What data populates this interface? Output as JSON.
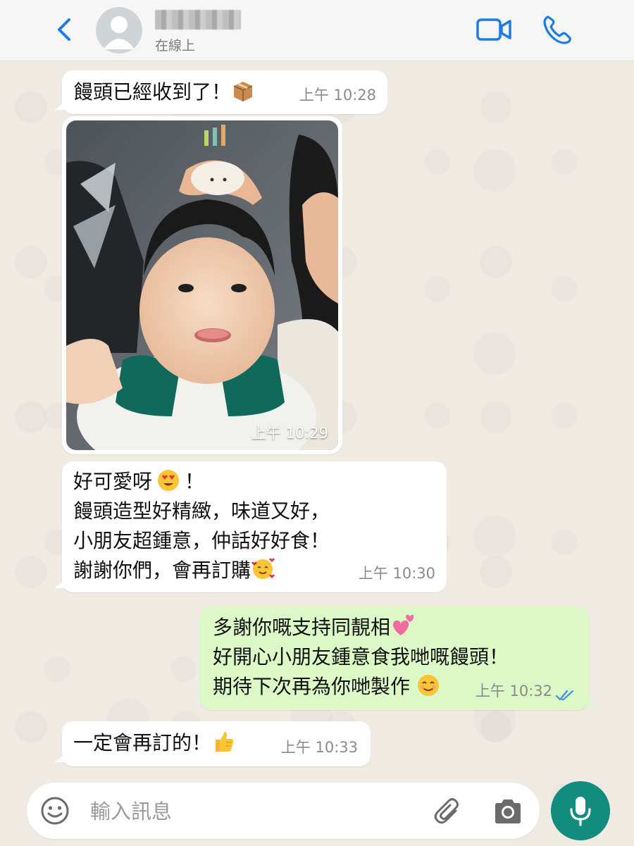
{
  "header": {
    "status": "在線上"
  },
  "messages": [
    {
      "id": "m1",
      "direction": "in",
      "lines": [
        "饅頭已經收到了！"
      ],
      "emoji": "package",
      "time": "上午 10:28"
    },
    {
      "id": "m2",
      "direction": "in",
      "type": "photo",
      "image": "toddler-with-cake-toy-on-head",
      "time": "上午 10:29"
    },
    {
      "id": "m3",
      "direction": "in",
      "lines": [
        "好可愛呀",
        "！",
        "饅頭造型好精緻，味道又好，",
        "小朋友超鍾意，仲話好好食！",
        "謝謝你們，會再訂購"
      ],
      "emoji": [
        "heart-eyes",
        "smiling-face-with-hearts"
      ],
      "time": "上午 10:30"
    },
    {
      "id": "m4",
      "direction": "out",
      "lines": [
        "多謝你嘅支持同靚相",
        "好開心小朋友鍾意食我哋嘅饅頭！",
        "期待下次再為你哋製作"
      ],
      "emoji": [
        "two-hearts",
        "smiling-face"
      ],
      "time": "上午 10:32",
      "read_receipt": "double-check-blue"
    },
    {
      "id": "m5",
      "direction": "in",
      "lines": [
        "一定會再訂的！"
      ],
      "emoji": "thumbs-up",
      "time": "上午 10:33"
    }
  ],
  "input": {
    "placeholder": "輸入訊息"
  },
  "icons": {
    "back": "chevron-left-icon",
    "video": "video-camera-icon",
    "call": "phone-icon",
    "emoji": "smiley-icon",
    "attach": "paperclip-icon",
    "camera": "camera-icon",
    "mic": "microphone-icon"
  },
  "colors": {
    "accent": "#1e7be6",
    "out_bubble": "#dcf8c6",
    "in_bubble": "#ffffff",
    "mic_button": "#128c7e",
    "read_tick": "#3a8ee6"
  }
}
